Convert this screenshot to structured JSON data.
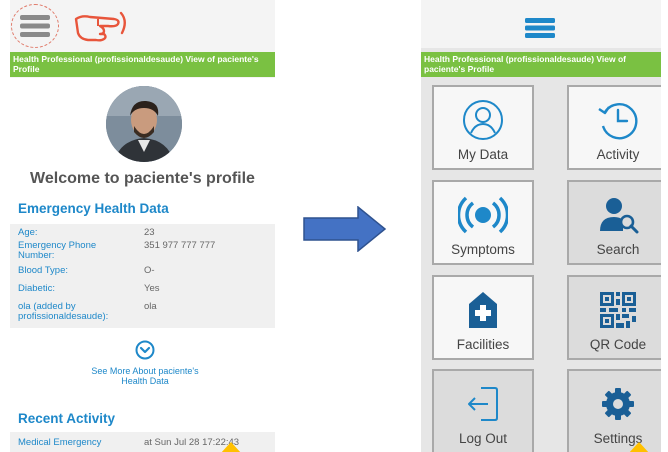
{
  "left_screen": {
    "banner": "Health Professional (profissionaldesaude) View of paciente's Profile",
    "welcome": "Welcome to paciente's profile",
    "emergency_title": "Emergency Health Data",
    "fields": [
      {
        "label": "Age:",
        "value": "23"
      },
      {
        "label": "Emergency Phone Number:",
        "value": "351 977 777 777"
      },
      {
        "label": "Blood Type:",
        "value": "O-"
      },
      {
        "label": "Diabetic:",
        "value": "Yes"
      },
      {
        "label": "ola (added by profissionaldesaude):",
        "value": "ola"
      }
    ],
    "see_more": "See More About paciente's Health Data",
    "recent_title": "Recent Activity",
    "activity": {
      "label": "Medical Emergency",
      "value": "at Sun Jul 28 17:22:43"
    }
  },
  "right_screen": {
    "banner": "Health Professional (profissionaldesaude) View of paciente's Profile",
    "tiles": [
      {
        "label": "My Data",
        "icon": "user-circle-icon"
      },
      {
        "label": "Activity",
        "icon": "history-clock-icon"
      },
      {
        "label": "Symptoms",
        "icon": "broadcast-icon"
      },
      {
        "label": "Search",
        "icon": "user-search-icon"
      },
      {
        "label": "Facilities",
        "icon": "hospital-icon"
      },
      {
        "label": "QR Code",
        "icon": "qr-code-icon"
      },
      {
        "label": "Log Out",
        "icon": "logout-icon"
      },
      {
        "label": "Settings",
        "icon": "gear-icon"
      }
    ]
  },
  "colors": {
    "banner_green": "#7ac142",
    "link_blue": "#1e88c9",
    "arrow_blue": "#4472c4",
    "hand_red": "#e8553b",
    "tap_yellow": "#ffc000"
  }
}
